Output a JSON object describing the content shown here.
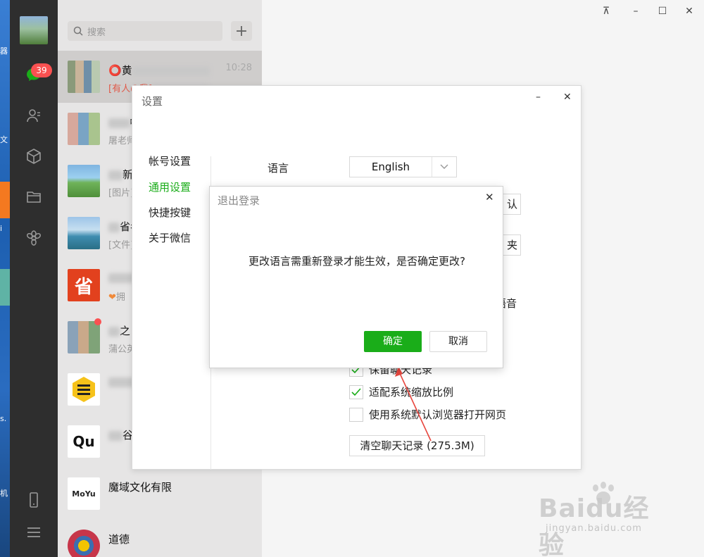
{
  "desktop": {
    "labels": [
      "器",
      "文",
      "i",
      "s.",
      "机"
    ]
  },
  "nav": {
    "badge": "39",
    "icons": [
      "chat-icon",
      "contacts-icon",
      "cube-icon",
      "folder-icon",
      "settings-flower-icon",
      "phone-icon",
      "menu-icon"
    ]
  },
  "search": {
    "placeholder": "搜索",
    "add": "+"
  },
  "chats": [
    {
      "name": "黄",
      "preview": "[有人@我]",
      "time": "10:28"
    },
    {
      "name": "中国",
      "preview": "屠老师"
    },
    {
      "name": "新",
      "preview": "[图片]"
    },
    {
      "name": "省考",
      "preview": "[文件]"
    },
    {
      "name": "",
      "preview": "拥",
      "avatar_text": "省"
    },
    {
      "name": "之",
      "preview": "蒲公英"
    },
    {
      "name": "",
      "preview": ""
    },
    {
      "name": "谷",
      "preview": "",
      "avatar_text": "Qu"
    },
    {
      "name": "魔域文化有限",
      "preview": "",
      "avatar_text": "MoYu"
    },
    {
      "name": "道德",
      "preview": ""
    }
  ],
  "window_controls": {
    "pin": "⊼",
    "minimize": "–",
    "maximize": "☐",
    "close": "✕"
  },
  "settings": {
    "title": "设置",
    "nav": [
      "帐号设置",
      "通用设置",
      "快捷按键",
      "关于微信"
    ],
    "language_label": "语言",
    "language_value": "English",
    "partial_1": "认",
    "partial_2": "夹",
    "partial_3": "语音",
    "checks": [
      {
        "label": "保留聊天记录",
        "checked": true
      },
      {
        "label": "适配系统缩放比例",
        "checked": true
      },
      {
        "label": "使用系统默认浏览器打开网页",
        "checked": false
      }
    ],
    "clear_button": "清空聊天记录 (275.3M)"
  },
  "confirm": {
    "title": "退出登录",
    "message": "更改语言需重新登录才能生效，是否确定更改?",
    "ok": "确定",
    "cancel": "取消"
  },
  "watermark": {
    "main": "Baidu经验",
    "sub": "jingyan.baidu.com"
  },
  "colors": {
    "accent": "#1aad19",
    "nav_bg": "#2e2e2e",
    "list_bg": "#e6e5e5",
    "badge": "#fa5151",
    "arrow": "#e8473f"
  }
}
